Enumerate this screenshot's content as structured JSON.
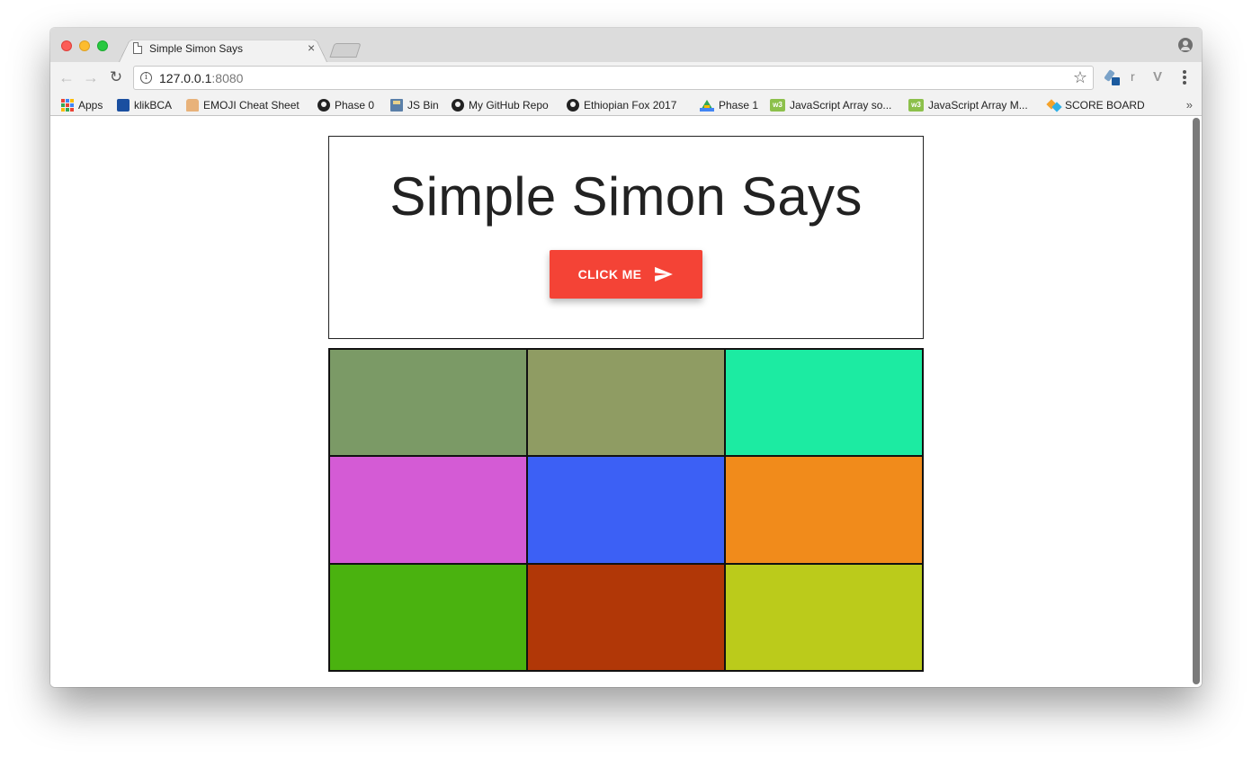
{
  "browser": {
    "tab_title": "Simple Simon Says",
    "tab_close": "×",
    "url_host": "127.0.0.1",
    "url_port": ":8080",
    "info_glyph": "i",
    "star_glyph": "☆",
    "ext_r": "r",
    "ext_v": "V",
    "more_bookmarks": "»",
    "bookmarks": [
      {
        "label": "Apps",
        "icon": "apps-grid-icon"
      },
      {
        "label": "klikBCA",
        "icon": "bca-icon"
      },
      {
        "label": "EMOJI Cheat Sheet",
        "icon": "thumbs-up-icon"
      },
      {
        "label": "Phase 0",
        "icon": "github-icon"
      },
      {
        "label": "JS Bin",
        "icon": "jsbin-icon"
      },
      {
        "label": "My GitHub Repo",
        "icon": "github-icon"
      },
      {
        "label": "Ethiopian Fox 2017",
        "icon": "github-icon"
      },
      {
        "label": "Phase 1",
        "icon": "google-drive-icon"
      },
      {
        "label": "JavaScript Array so...",
        "icon": "w3schools-icon"
      },
      {
        "label": "JavaScript Array M...",
        "icon": "w3schools-icon"
      },
      {
        "label": "SCORE BOARD",
        "icon": "scoreboard-icon"
      }
    ]
  },
  "page": {
    "title": "Simple Simon Says",
    "button_label": "CLICK ME",
    "button_color": "#f44336",
    "tiles": [
      {
        "color": "#7b9a66"
      },
      {
        "color": "#8f9c63"
      },
      {
        "color": "#1ceba2"
      },
      {
        "color": "#d45bd5"
      },
      {
        "color": "#3c60f5"
      },
      {
        "color": "#f18b1b"
      },
      {
        "color": "#4ab20f"
      },
      {
        "color": "#b13707"
      },
      {
        "color": "#bbcb1b"
      }
    ]
  }
}
